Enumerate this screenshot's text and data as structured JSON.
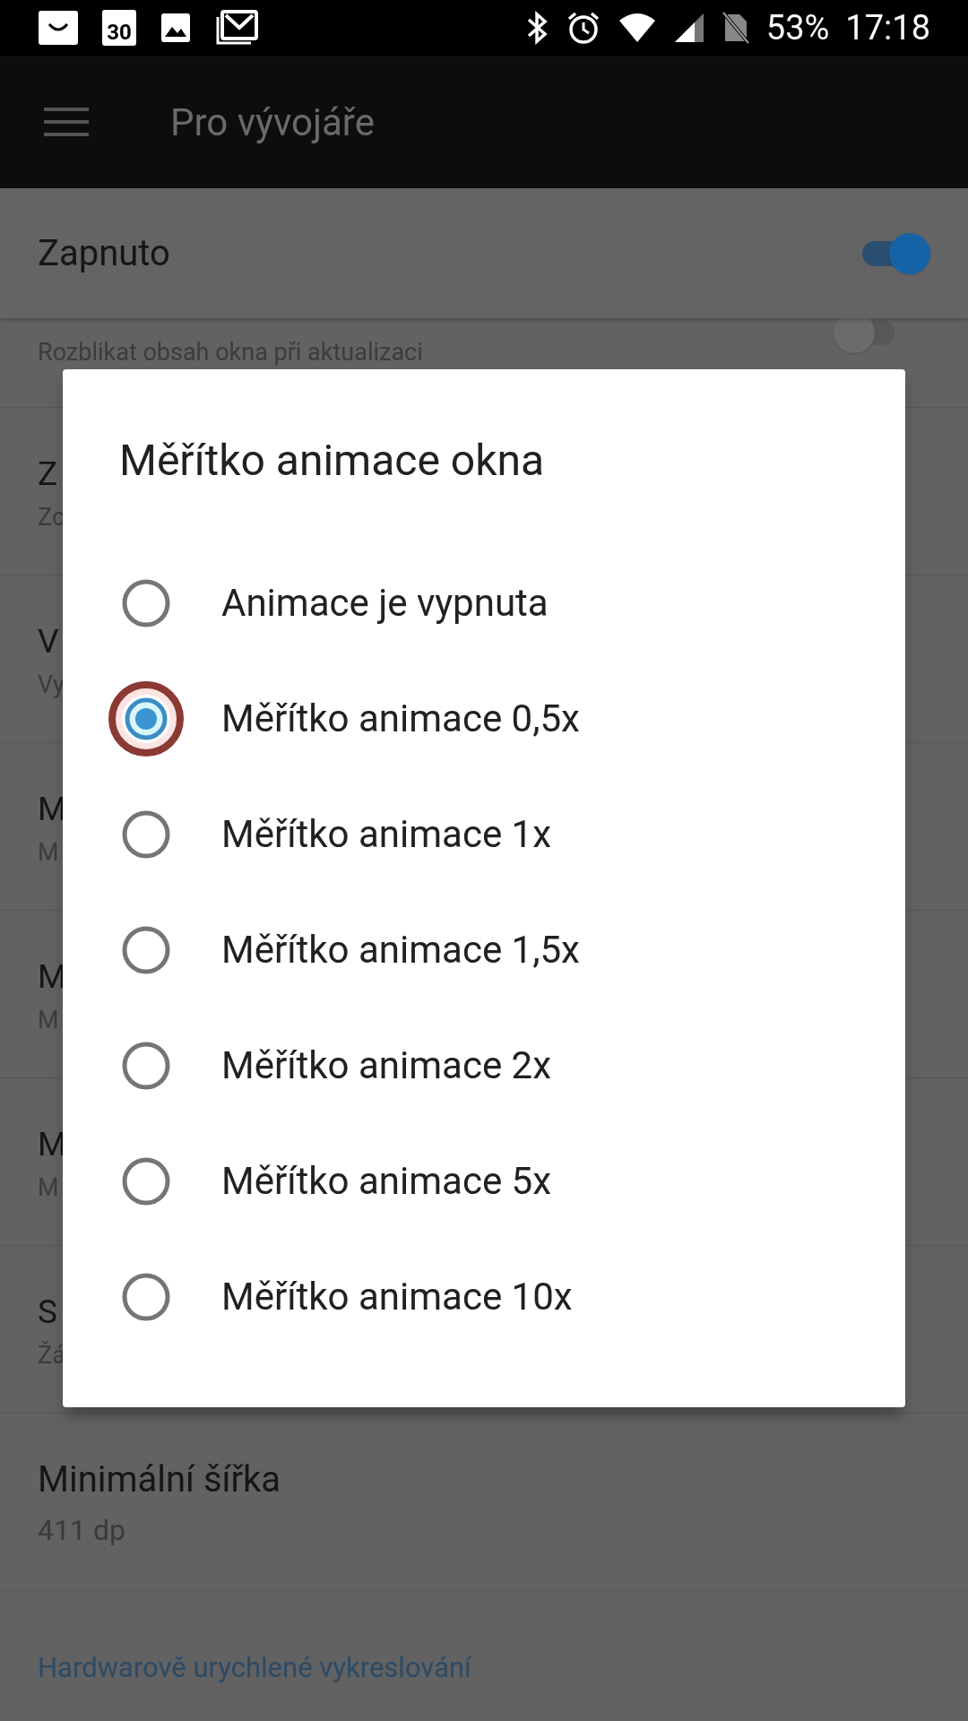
{
  "status_bar": {
    "calendar_day": "30",
    "battery": "53%",
    "time": "17:18"
  },
  "app_bar": {
    "title": "Pro vývojáře"
  },
  "master_switch": {
    "label": "Zapnuto",
    "on": true
  },
  "background_rows": [
    {
      "subtitle": "Rozblikat obsah okna při aktualizaci",
      "switch_on": false
    },
    {
      "title": "Z",
      "subtitle": "Zo"
    },
    {
      "title": "V",
      "subtitle": "Vy"
    },
    {
      "title": "M",
      "subtitle": "M"
    },
    {
      "title": "M",
      "subtitle": "M"
    },
    {
      "title": "M",
      "subtitle": "M"
    },
    {
      "title": "S",
      "subtitle": "Žá"
    },
    {
      "title": "Minimální šířka",
      "subtitle": "411 dp"
    }
  ],
  "category_header": "Hardwarově urychlené vykreslování",
  "dialog": {
    "title": "Měřítko animace okna",
    "options": [
      {
        "label": "Animace je vypnuta",
        "selected": false
      },
      {
        "label": "Měřítko animace 0,5x",
        "selected": true
      },
      {
        "label": "Měřítko animace 1x",
        "selected": false
      },
      {
        "label": "Měřítko animace 1,5x",
        "selected": false
      },
      {
        "label": "Měřítko animace 2x",
        "selected": false
      },
      {
        "label": "Měřítko animace 5x",
        "selected": false
      },
      {
        "label": "Měřítko animace 10x",
        "selected": false
      }
    ]
  }
}
